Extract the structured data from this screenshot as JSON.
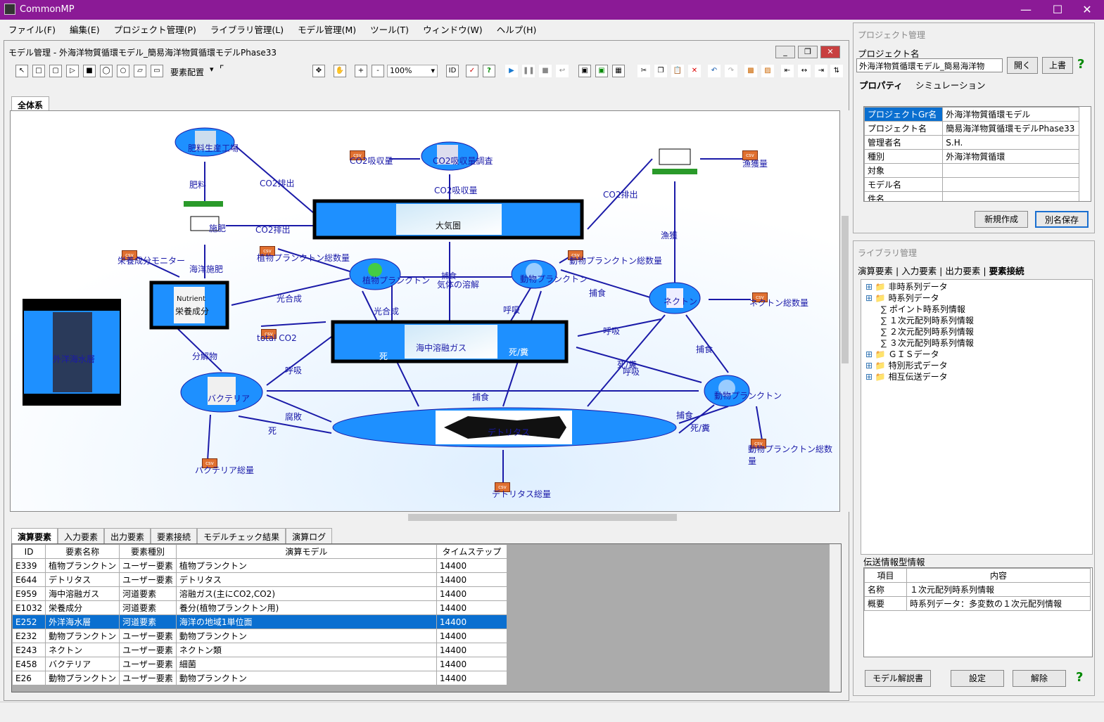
{
  "app": {
    "title": "CommonMP"
  },
  "menu": [
    "ファイル(F)",
    "編集(E)",
    "プロジェクト管理(P)",
    "ライブラリ管理(L)",
    "モデル管理(M)",
    "ツール(T)",
    "ウィンドウ(W)",
    "ヘルプ(H)"
  ],
  "model_window": {
    "title": "モデル管理 - 外海洋物質循環モデル_簡易海洋物質循環モデルPhase33",
    "toolbar": {
      "layout_label": "要素配置",
      "zoom": "100%"
    },
    "top_tab": "全体系"
  },
  "diagram": {
    "nodes": {
      "fertilizer_factory": "肥料生産工場",
      "co2_survey": "CO2吸収量調査",
      "co2_absorb_csv": "CO2吸収量",
      "fishing_ship": "",
      "catch_csv": "漁獲量",
      "fert_ship": "施肥",
      "atmosphere": "大気圏",
      "nutrient_monitor": "栄養成分モニター",
      "phyto_total1": "植物プランクトン総数量",
      "zoo_total1": "動物プランクトン総数量",
      "phyto": "植物プランクトン",
      "zoo": "動物プランクトン",
      "nekton": "ネクトン",
      "nekton_total": "ネクトン総数量",
      "nutrient": "栄養成分",
      "nutrient_tag": "Nutrient",
      "outer_water": "外洋海水層",
      "total_co2": "total CO2",
      "dissolved_gas": "海中溶融ガス",
      "bacteria": "バクテリア",
      "zoo2": "動物プランクトン",
      "detritus": "デトリタス",
      "bacteria_total": "バクテリア総量",
      "detritus_total": "デトリタス総量",
      "zoo_total2": "動物プランクトン総数量"
    },
    "edges": {
      "fertilizer": "肥料",
      "co2_emit1": "CO2排出",
      "co2_emit2": "CO2排出",
      "co2_absorb": "CO2吸収量",
      "co2_emit3": "CO2排出",
      "ocean_fert": "海洋施肥",
      "photosyn1": "光合成",
      "photosyn2": "光合成",
      "gas_dissolve": "気体の溶解",
      "capture1": "捕食",
      "capture2": "捕食",
      "capture3": "捕食",
      "capture4": "捕食",
      "capture5": "捕食",
      "fishing": "漁獲",
      "respire1": "呼吸",
      "respire2": "呼吸",
      "respire3": "呼吸",
      "respire4": "呼吸",
      "decompose": "分解物",
      "death1": "死",
      "death2": "死",
      "death_feces1": "死/糞",
      "death_feces2": "死/糞",
      "death_feces3": "死/糞",
      "decay": "腐敗"
    }
  },
  "bottom_tabs": [
    "演算要素",
    "入力要素",
    "出力要素",
    "要素接続",
    "モデルチェック結果",
    "演算ログ"
  ],
  "table": {
    "headers": [
      "ID",
      "要素名称",
      "要素種別",
      "演算モデル",
      "タイムステップ"
    ],
    "rows": [
      [
        "E339",
        "植物プランクトン",
        "ユーザー要素",
        "植物プランクトン",
        "14400"
      ],
      [
        "E644",
        "デトリタス",
        "ユーザー要素",
        "デトリタス",
        "14400"
      ],
      [
        "E959",
        "海中溶融ガス",
        "河道要素",
        "溶融ガス(主にCO2,CO2)",
        "14400"
      ],
      [
        "E1032",
        "栄養成分",
        "河道要素",
        "養分(植物プランクトン用)",
        "14400"
      ],
      [
        "E252",
        "外洋海水層",
        "河道要素",
        "海洋の地域1単位面",
        "14400"
      ],
      [
        "E232",
        "動物プランクトン",
        "ユーザー要素",
        "動物プランクトン",
        "14400"
      ],
      [
        "E243",
        "ネクトン",
        "ユーザー要素",
        "ネクトン類",
        "14400"
      ],
      [
        "E458",
        "バクテリア",
        "ユーザー要素",
        "細菌",
        "14400"
      ],
      [
        "E26",
        "動物プランクトン",
        "ユーザー要素",
        "動物プランクトン",
        "14400"
      ]
    ],
    "selected_row": 4
  },
  "project_window": {
    "title": "プロジェクト管理",
    "project_name_label": "プロジェクト名",
    "project_name_value": "外海洋物質循環モデル_簡易海洋物",
    "open_button": "開く",
    "overwrite_button": "上書",
    "tabs": [
      "プロパティ",
      "シミュレーション"
    ],
    "properties": [
      [
        "プロジェクトGr名",
        "外海洋物質循環モデル"
      ],
      [
        "プロジェクト名",
        "簡易海洋物質循環モデルPhase33"
      ],
      [
        "管理者名",
        "S.H."
      ],
      [
        "種別",
        "外海洋物質循環"
      ],
      [
        "対象",
        ""
      ],
      [
        "モデル名",
        ""
      ],
      [
        "件名",
        ""
      ]
    ],
    "new_button": "新規作成",
    "save_as_button": "別名保存"
  },
  "library_window": {
    "title": "ライブラリ管理",
    "tabs": [
      "演算要素",
      "入力要素",
      "出力要素",
      "要素接続"
    ],
    "tree": [
      {
        "label": "非時系列データ",
        "level": 0,
        "type": "folder"
      },
      {
        "label": "時系列データ",
        "level": 0,
        "type": "folder"
      },
      {
        "label": "ポイント時系列情報",
        "level": 1,
        "type": "item"
      },
      {
        "label": "１次元配列時系列情報",
        "level": 1,
        "type": "item"
      },
      {
        "label": "２次元配列時系列情報",
        "level": 1,
        "type": "item"
      },
      {
        "label": "３次元配列時系列情報",
        "level": 1,
        "type": "item"
      },
      {
        "label": "ＧＩＳデータ",
        "level": 0,
        "type": "folder"
      },
      {
        "label": "特別形式データ",
        "level": 0,
        "type": "folder"
      },
      {
        "label": "相互伝送データ",
        "level": 0,
        "type": "folder"
      }
    ],
    "info_title": "伝送情報型情報",
    "info_headers": [
      "項目",
      "内容"
    ],
    "info_rows": [
      [
        "名称",
        "１次元配列時系列情報"
      ],
      [
        "概要",
        "時系列データ：多変数の１次元配列情報"
      ]
    ],
    "model_doc_button": "モデル解説書",
    "set_button": "設定",
    "release_button": "解除"
  },
  "colors": {
    "titlebar": "#8b1a96",
    "node_blue": "#1e90ff",
    "edge": "#1a1aa8",
    "selection": "#0a6fd0"
  }
}
